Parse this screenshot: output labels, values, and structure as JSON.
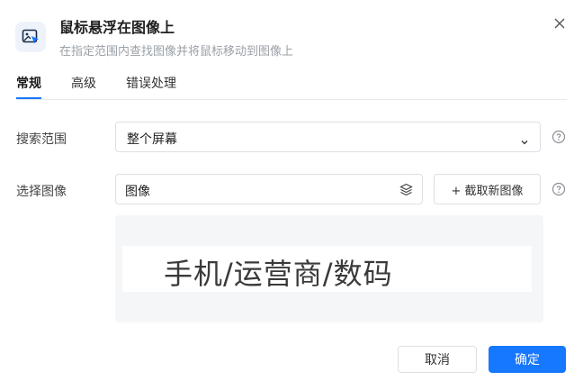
{
  "dialog": {
    "title": "鼠标悬浮在图像上",
    "subtitle": "在指定范围内查找图像并将鼠标移动到图像上",
    "icon": "image-cursor-icon",
    "close_icon": "close-icon"
  },
  "tabs": [
    {
      "label": "常规",
      "active": true
    },
    {
      "label": "高级",
      "active": false
    },
    {
      "label": "错误处理",
      "active": false
    }
  ],
  "fields": {
    "search_scope": {
      "label": "搜索范围",
      "value": "整个屏幕",
      "icon": "chevron-down-icon"
    },
    "select_image": {
      "label": "选择图像",
      "value": "图像",
      "icon": "layers-icon",
      "capture_button": "+ 截取新图像"
    }
  },
  "preview": {
    "text": "手机/运营商/数码"
  },
  "footer": {
    "cancel_label": "取消",
    "ok_label": "确定"
  },
  "colors": {
    "accent": "#1677ff",
    "preview_bg": "#f5f6f8"
  }
}
